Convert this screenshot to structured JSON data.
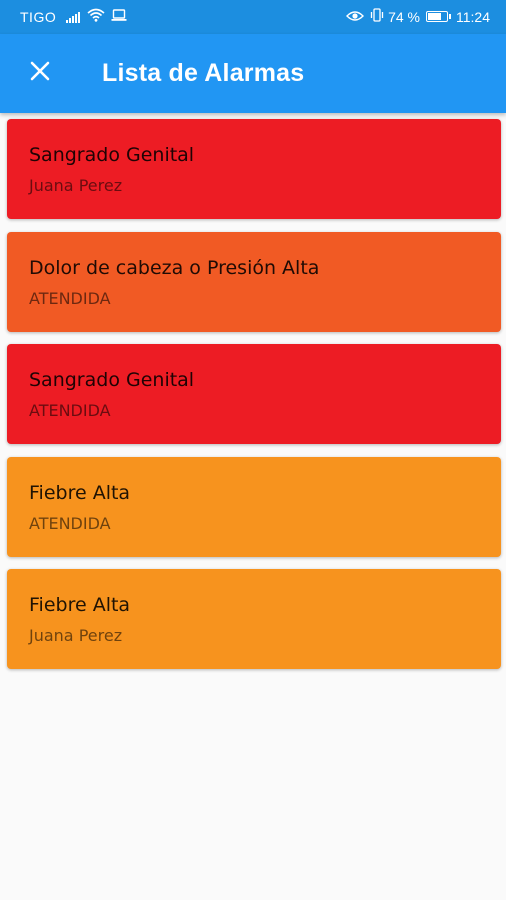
{
  "status_bar": {
    "carrier": "TIGO",
    "battery_percent": "74 %",
    "battery_level": 0.74,
    "time": "11:24",
    "icons": [
      "signal-icon",
      "wifi-icon",
      "laptop-icon",
      "eye-icon",
      "vibrate-icon",
      "battery-icon"
    ]
  },
  "app_bar": {
    "title": "Lista de Alarmas",
    "close_icon": "close-icon",
    "background": "#2196f3"
  },
  "alarms": [
    {
      "title": "Sangrado Genital",
      "subtitle": "Juana Perez",
      "color": "#ed1c24"
    },
    {
      "title": "Dolor de cabeza o Presión Alta",
      "subtitle": "ATENDIDA",
      "color": "#f15a24"
    },
    {
      "title": "Sangrado Genital",
      "subtitle": "ATENDIDA",
      "color": "#ed1c24"
    },
    {
      "title": "Fiebre Alta",
      "subtitle": "ATENDIDA",
      "color": "#f7931e"
    },
    {
      "title": "Fiebre Alta",
      "subtitle": "Juana Perez",
      "color": "#f7931e"
    }
  ]
}
